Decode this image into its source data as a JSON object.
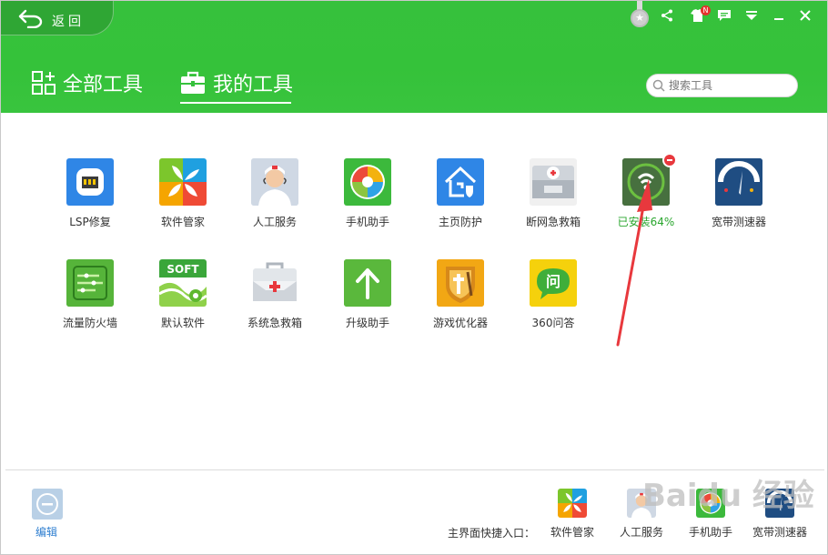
{
  "header": {
    "back_label": "返回",
    "nav_all_label": "全部工具",
    "nav_mine_label": "我的工具",
    "search_placeholder": "搜索工具",
    "notification_badge": "N"
  },
  "tools": [
    {
      "label": "LSP修复",
      "icon": "lsp-repair-icon"
    },
    {
      "label": "软件管家",
      "icon": "software-manager-icon"
    },
    {
      "label": "人工服务",
      "icon": "human-service-icon"
    },
    {
      "label": "手机助手",
      "icon": "phone-assistant-icon"
    },
    {
      "label": "主页防护",
      "icon": "homepage-protect-icon"
    },
    {
      "label": "断网急救箱",
      "icon": "network-firstaid-icon"
    },
    {
      "label": "已安装64%",
      "icon": "wifi-install-icon",
      "progress_percent": 64
    },
    {
      "label": "宽带测速器",
      "icon": "speedtest-icon"
    },
    {
      "label": "流量防火墙",
      "icon": "traffic-firewall-icon"
    },
    {
      "label": "默认软件",
      "icon": "default-software-icon"
    },
    {
      "label": "系统急救箱",
      "icon": "system-firstaid-icon"
    },
    {
      "label": "升级助手",
      "icon": "upgrade-assistant-icon"
    },
    {
      "label": "游戏优化器",
      "icon": "game-optimizer-icon"
    },
    {
      "label": "360问答",
      "icon": "qa-360-icon"
    }
  ],
  "footer": {
    "edit_label": "编辑",
    "shortcut_label": "主界面快捷入口：",
    "quick": [
      {
        "label": "软件管家",
        "icon": "software-manager-icon"
      },
      {
        "label": "人工服务",
        "icon": "human-service-icon"
      },
      {
        "label": "手机助手",
        "icon": "phone-assistant-icon"
      },
      {
        "label": "宽带测速器",
        "icon": "speedtest-icon"
      }
    ]
  },
  "watermark": "Baidu 经验",
  "colors": {
    "header_green": "#36c13c",
    "installed_green": "#2aa62e",
    "remove_red": "#e8383d",
    "edit_blue": "#2f7fd0"
  }
}
